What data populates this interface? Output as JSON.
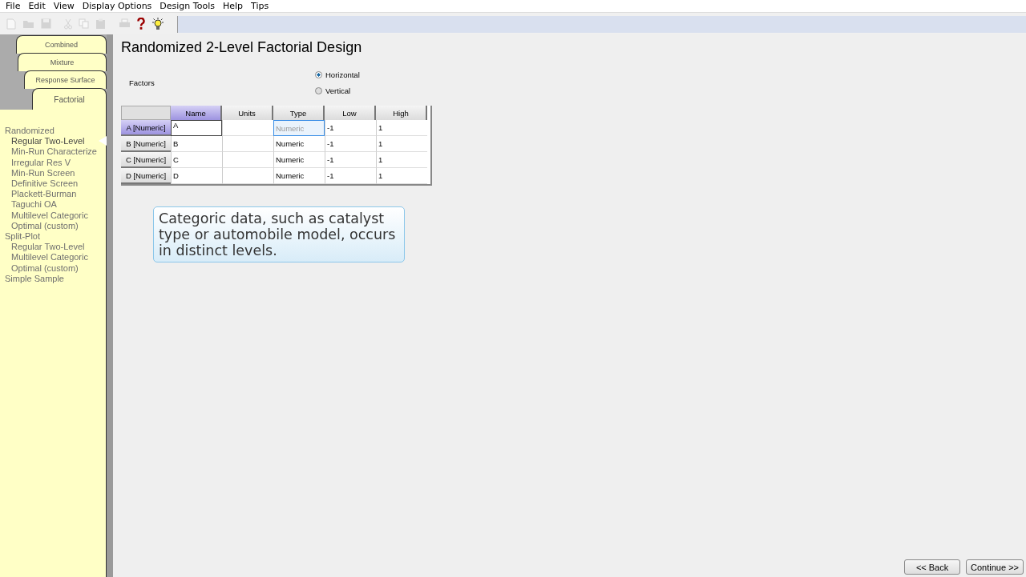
{
  "menu": [
    "File",
    "Edit",
    "View",
    "Display Options",
    "Design Tools",
    "Help",
    "Tips"
  ],
  "toolbar": [
    {
      "kind": "new",
      "disabled": true
    },
    {
      "kind": "open",
      "disabled": true
    },
    {
      "kind": "save",
      "disabled": true
    },
    {
      "kind": "cut",
      "disabled": true
    },
    {
      "kind": "copy",
      "disabled": true
    },
    {
      "kind": "paste",
      "disabled": true
    },
    {
      "kind": "print",
      "disabled": true
    },
    {
      "kind": "help",
      "disabled": false
    },
    {
      "kind": "tip",
      "disabled": false
    }
  ],
  "sidebar": {
    "tabs": [
      {
        "label": "Combined",
        "selected": false
      },
      {
        "label": "Mixture",
        "selected": false
      },
      {
        "label": "Response Surface",
        "selected": false
      },
      {
        "label": "Factorial",
        "selected": true
      }
    ],
    "tree": [
      {
        "label": "Randomized",
        "selected": false,
        "children": [
          {
            "label": "Regular Two-Level",
            "selected": true
          },
          {
            "label": "Min-Run Characterize",
            "selected": false
          },
          {
            "label": "Irregular Res V",
            "selected": false
          },
          {
            "label": "Min-Run Screen",
            "selected": false
          },
          {
            "label": "Definitive Screen",
            "selected": false
          },
          {
            "label": "Plackett-Burman",
            "selected": false
          },
          {
            "label": "Taguchi OA",
            "selected": false
          },
          {
            "label": "Multilevel Categoric",
            "selected": false
          },
          {
            "label": "Optimal (custom)",
            "selected": false
          }
        ]
      },
      {
        "label": "Split-Plot",
        "selected": false,
        "children": [
          {
            "label": "Regular Two-Level",
            "selected": false
          },
          {
            "label": "Multilevel Categoric",
            "selected": false
          },
          {
            "label": "Optimal (custom)",
            "selected": false
          }
        ]
      },
      {
        "label": "Simple Sample",
        "selected": false
      }
    ]
  },
  "title": "Randomized 2-Level Factorial Design",
  "factors_label": "Factors",
  "orientation": [
    {
      "label": "Horizontal",
      "selected": true
    },
    {
      "label": "Vertical",
      "selected": false
    }
  ],
  "table": {
    "columns": [
      {
        "label": "Name",
        "selected": true
      },
      {
        "label": "Units",
        "selected": false
      },
      {
        "label": "Type",
        "selected": false
      },
      {
        "label": "Low",
        "selected": false
      },
      {
        "label": "High",
        "selected": false
      }
    ],
    "rows": [
      {
        "header": "A [Numeric]",
        "selected": true,
        "cells": [
          {
            "value": "A",
            "focused": false
          },
          {
            "focused": false
          },
          {
            "value": "Numeric",
            "focused": true
          },
          {
            "value": "-1",
            "focused": false
          },
          {
            "value": "1",
            "focused": false
          }
        ]
      },
      {
        "header": "B [Numeric]",
        "selected": false,
        "cells": [
          {
            "value": "B",
            "focused": false
          },
          {
            "focused": false
          },
          {
            "value": "Numeric",
            "focused": false
          },
          {
            "value": "-1",
            "focused": false
          },
          {
            "value": "1",
            "focused": false
          }
        ]
      },
      {
        "header": "C [Numeric]",
        "selected": false,
        "cells": [
          {
            "value": "C",
            "focused": false
          },
          {
            "focused": false
          },
          {
            "value": "Numeric",
            "focused": false
          },
          {
            "value": "-1",
            "focused": false
          },
          {
            "value": "1",
            "focused": false
          }
        ]
      },
      {
        "header": "D [Numeric]",
        "selected": false,
        "cells": [
          {
            "value": "D",
            "focused": false
          },
          {
            "focused": false
          },
          {
            "value": "Numeric",
            "focused": false
          },
          {
            "value": "-1",
            "focused": false
          },
          {
            "value": "1",
            "focused": false
          }
        ]
      }
    ]
  },
  "callout": "Categoric data, such as catalyst type or automobile model, occurs in distinct levels.",
  "buttons": [
    "<< Back",
    "Continue >>"
  ]
}
